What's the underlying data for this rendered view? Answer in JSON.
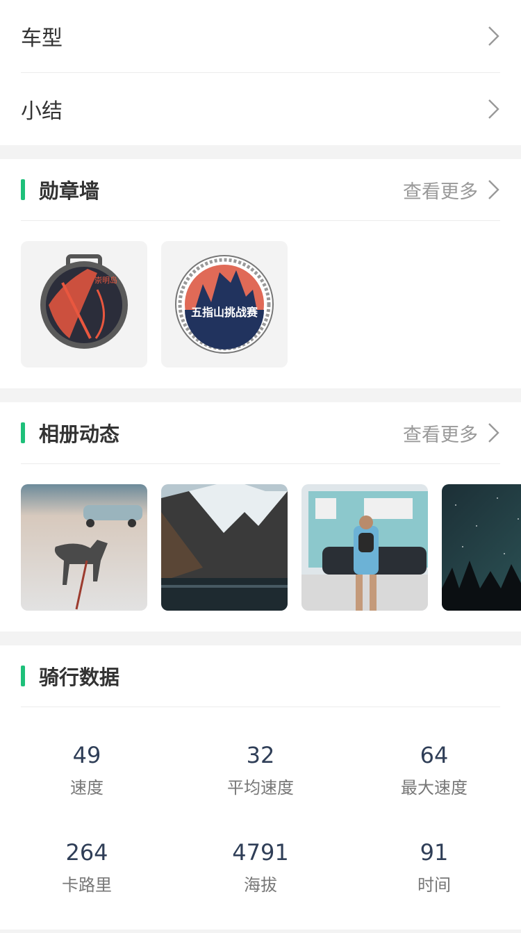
{
  "settings": {
    "items": [
      {
        "label": "车型"
      },
      {
        "label": "小结"
      }
    ]
  },
  "medals": {
    "title": "勋章墙",
    "more": "查看更多",
    "medal2_text": "五指山挑战赛",
    "medal1_text": "崇明岛"
  },
  "album": {
    "title": "相册动态",
    "more": "查看更多"
  },
  "ride": {
    "title": "骑行数据",
    "stats": [
      {
        "value": "49",
        "label": "速度"
      },
      {
        "value": "32",
        "label": "平均速度"
      },
      {
        "value": "64",
        "label": "最大速度"
      },
      {
        "value": "264",
        "label": "卡路里"
      },
      {
        "value": "4791",
        "label": "海拔"
      },
      {
        "value": "91",
        "label": "时间"
      }
    ]
  },
  "colors": {
    "accent": "#1ec07a",
    "value_text": "#2f3e57"
  }
}
